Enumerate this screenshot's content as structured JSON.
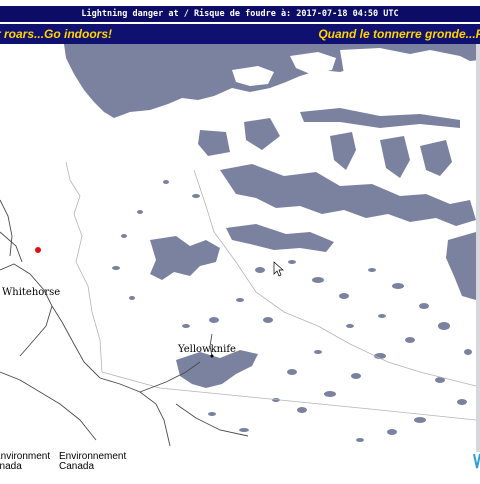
{
  "header": {
    "title": "Lightning danger at / Risque de foudre à: 2017-07-18 04:50 UTC"
  },
  "warning": {
    "left_text": "r roars...Go indoors!",
    "right_text": "Quand le tonnerre gronde...F"
  },
  "map": {
    "labels": {
      "whitehorse": "Whitehorse",
      "yellowknife": "Yellowknife"
    },
    "lightning_marker_color": "#e01010",
    "water_color": "#7a82a0",
    "land_color": "#ffffff"
  },
  "footer": {
    "logo_fr_line1": "Environment",
    "logo_fr_line2": "anada",
    "logo_en_line1": "Environnement",
    "logo_en_line2": "Canada"
  },
  "colors": {
    "title_bar": "#0c0c66",
    "warning_bar": "#101070",
    "warning_text": "#ffd400"
  }
}
